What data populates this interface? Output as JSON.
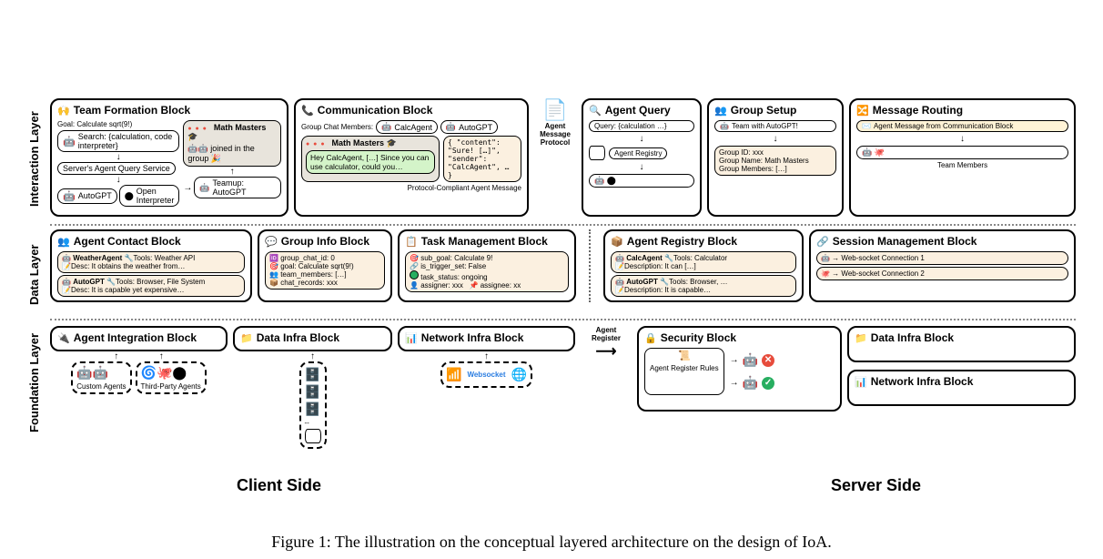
{
  "layers": {
    "interaction": "Interaction Layer",
    "data": "Data Layer",
    "foundation": "Foundation Layer"
  },
  "sides": {
    "client": "Client Side",
    "server": "Server Side"
  },
  "caption": "Figure 1: The illustration on the conceptual layered architecture on the design of IoA.",
  "protocol_label": "Agent Message Protocol",
  "agent_register_label": "Agent Register",
  "client": {
    "team_formation": {
      "title": "Team Formation Block",
      "goal": "Goal: Calculate sqrt(9!)",
      "search": "Search: {calculation, code interpreter}",
      "server_query": "Server's Agent Query Service",
      "window_title": "Math Masters",
      "joined": "joined in the group",
      "agents": {
        "autogpt": "AutoGPT",
        "oi": "Open Interpreter"
      },
      "teamup": "Teamup: AutoGPT"
    },
    "communication": {
      "title": "Communication Block",
      "members_label": "Group Chat Members:",
      "members": {
        "calc": "CalcAgent",
        "autogpt": "AutoGPT"
      },
      "window_title": "Math Masters",
      "bubble": "Hey CalcAgent, […] Since you can use calculator, could you…",
      "json": "{ \"content\": \"Sure! […]\", \"sender\": \"CalcAgent\", … }",
      "footer": "Protocol-Compliant Agent Message"
    },
    "agent_contact": {
      "title": "Agent Contact Block",
      "row1_name": "WeatherAgent",
      "row1_tools": "Tools: Weather API",
      "row1_desc": "Desc: It obtains the weather from…",
      "row2_name": "AutoGPT",
      "row2_tools": "Tools: Browser, File System",
      "row2_desc": "Desc: It is capable yet expensive…"
    },
    "group_info": {
      "title": "Group Info Block",
      "l1": "group_chat_id: 0",
      "l2": "goal: Calculate sqrt(9!)",
      "l3": "team_members: […]",
      "l4": "chat_records: xxx"
    },
    "task_mgmt": {
      "title": "Task Management Block",
      "l1": "sub_goal: Calculate 9!",
      "l2": "is_trigger_set: False",
      "l3": "task_status: ongoing",
      "l4a": "assigner: xxx",
      "l4b": "assignee: xx"
    },
    "agent_integration": {
      "title": "Agent Integration Block",
      "custom": "Custom Agents",
      "third": "Third-Party Agents"
    },
    "data_infra": {
      "title": "Data Infra Block"
    },
    "network_infra": {
      "title": "Network Infra Block",
      "ws": "Websocket"
    }
  },
  "server": {
    "agent_query": {
      "title": "Agent Query",
      "query": "Query: {calculation …}",
      "registry": "Agent Registry"
    },
    "group_setup": {
      "title": "Group Setup",
      "req": "Team with AutoGPT!",
      "l1": "Group ID: xxx",
      "l2": "Group Name: Math Masters",
      "l3": "Group Members: […]"
    },
    "message_routing": {
      "title": "Message Routing",
      "msg": "Agent Message from Communication Block",
      "team": "Team Members"
    },
    "agent_registry": {
      "title": "Agent Registry Block",
      "r1_name": "CalcAgent",
      "r1_tools": "Tools: Calculator",
      "r1_desc": "Description: It can […]",
      "r2_name": "AutoGPT",
      "r2_tools": "Tools: Browser, …",
      "r2_desc": "Description: It is capable…"
    },
    "session_mgmt": {
      "title": "Session Management Block",
      "c1": "Web-socket Connection 1",
      "c2": "Web-socket Connection 2"
    },
    "security": {
      "title": "Security Block",
      "rules": "Agent Register Rules"
    },
    "data_infra": {
      "title": "Data Infra Block"
    },
    "network_infra": {
      "title": "Network Infra Block"
    }
  }
}
